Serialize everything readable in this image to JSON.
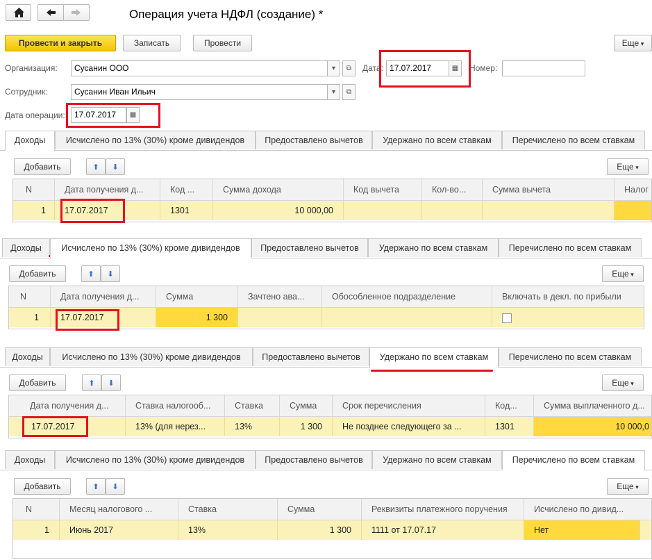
{
  "window": {
    "title": "Операция учета НДФЛ (создание) *"
  },
  "toolbar": {
    "post_close": "Провести и закрыть",
    "save": "Записать",
    "post": "Провести",
    "more": "Еще"
  },
  "form": {
    "org_label": "Организация:",
    "org_value": "Сусанин ООО",
    "date_label": "Дата:",
    "date_value": "17.07.2017",
    "number_label": "Номер:",
    "number_value": "",
    "employee_label": "Сотрудник:",
    "employee_value": "Сусанин Иван Ильич",
    "op_date_label": "Дата операции:",
    "op_date_value": "17.07.2017"
  },
  "tabs": [
    "Доходы",
    "Исчислено по 13% (30%) кроме дивидендов",
    "Предоставлено вычетов",
    "Удержано по всем ставкам",
    "Перечислено по всем ставкам"
  ],
  "common": {
    "add": "Добавить",
    "more": "Еще"
  },
  "panel1": {
    "headers": [
      "N",
      "Дата получения д...",
      "Код ...",
      "Сумма дохода",
      "Код вычета",
      "Кол-во...",
      "Сумма вычета",
      "Налог"
    ],
    "row": [
      "1",
      "17.07.2017",
      "1301",
      "10 000,00",
      "",
      "",
      "",
      ""
    ]
  },
  "panel2": {
    "headers": [
      "N",
      "Дата получения д...",
      "Сумма",
      "Зачтено ава...",
      "Обособленное подразделение",
      "Включать в декл. по прибыли"
    ],
    "row": [
      "1",
      "17.07.2017",
      "1 300",
      "",
      "",
      ""
    ]
  },
  "panel3": {
    "headers": [
      "Дата получения д...",
      "Ставка налогооб...",
      "Ставка",
      "Сумма",
      "Срок перечисления",
      "Код...",
      "Сумма выплаченного д..."
    ],
    "row": [
      "17.07.2017",
      "13% (для нерез...",
      "13%",
      "1 300",
      "Не позднее следующего за ...",
      "1301",
      "10 000,0"
    ]
  },
  "panel4": {
    "headers": [
      "N",
      "Месяц налогового ...",
      "Ставка",
      "Сумма",
      "Реквизиты платежного поручения",
      "Исчислено по дивид..."
    ],
    "row": [
      "1",
      "Июнь 2017",
      "13%",
      "1 300",
      "1111 от 17.07.17",
      "Нет"
    ]
  },
  "colors": {
    "highlight": "#e2131f",
    "accent": "#f3c300",
    "row": "#fbf2b9"
  }
}
